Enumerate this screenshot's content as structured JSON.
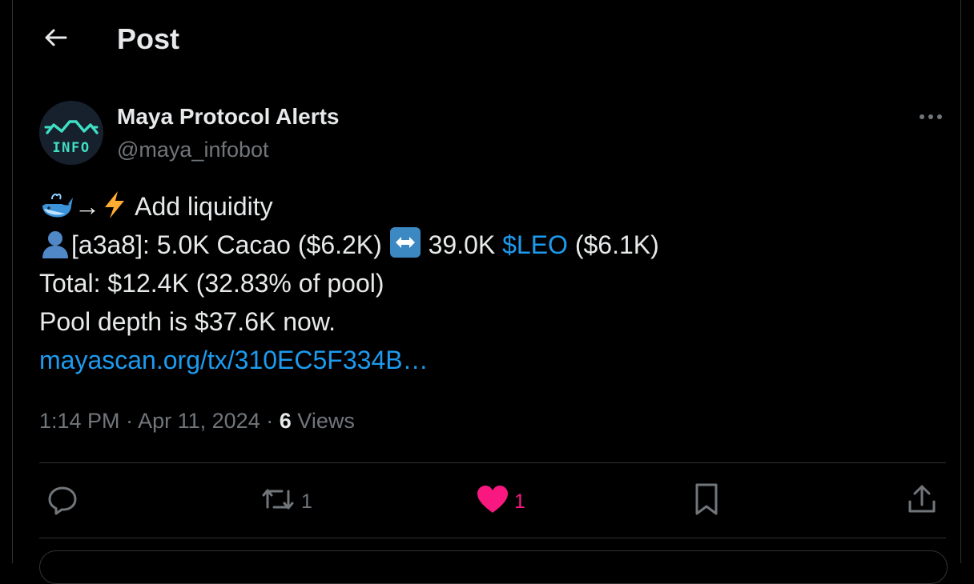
{
  "header": {
    "title": "Post",
    "back_icon": "arrow-left-icon"
  },
  "author": {
    "display_name": "Maya Protocol Alerts",
    "handle": "@maya_infobot",
    "avatar_label": "INFO",
    "avatar_colors": {
      "bg": "#17202d",
      "accent": "#3ee0c4"
    }
  },
  "post": {
    "line1_text": "Add liquidity",
    "line1_arrow": "→",
    "line2_prefix": "[a3a8]: 5.0K Cacao ($6.2K)",
    "line2_mid": "39.0K",
    "line2_cashtag": "$LEO",
    "line2_suffix": "($6.1K)",
    "line3": "Total: $12.4K (32.83% of pool)",
    "line4": "Pool depth is $37.6K now.",
    "link": "mayascan.org/tx/310EC5F334B…"
  },
  "meta": {
    "time": "1:14 PM",
    "separator": "·",
    "date": "Apr 11, 2024",
    "views_count": "6",
    "views_label": "Views"
  },
  "actions": {
    "reply": {
      "icon": "reply-icon",
      "count": ""
    },
    "repost": {
      "icon": "repost-icon",
      "count": "1"
    },
    "like": {
      "icon": "heart-icon",
      "count": "1",
      "color": "#f91880"
    },
    "bookmark": {
      "icon": "bookmark-icon"
    },
    "share": {
      "icon": "share-icon"
    }
  },
  "colors": {
    "background": "#000000",
    "text": "#e7e9ea",
    "muted": "#71767b",
    "link": "#1d9bf0",
    "border": "#2f3336"
  }
}
